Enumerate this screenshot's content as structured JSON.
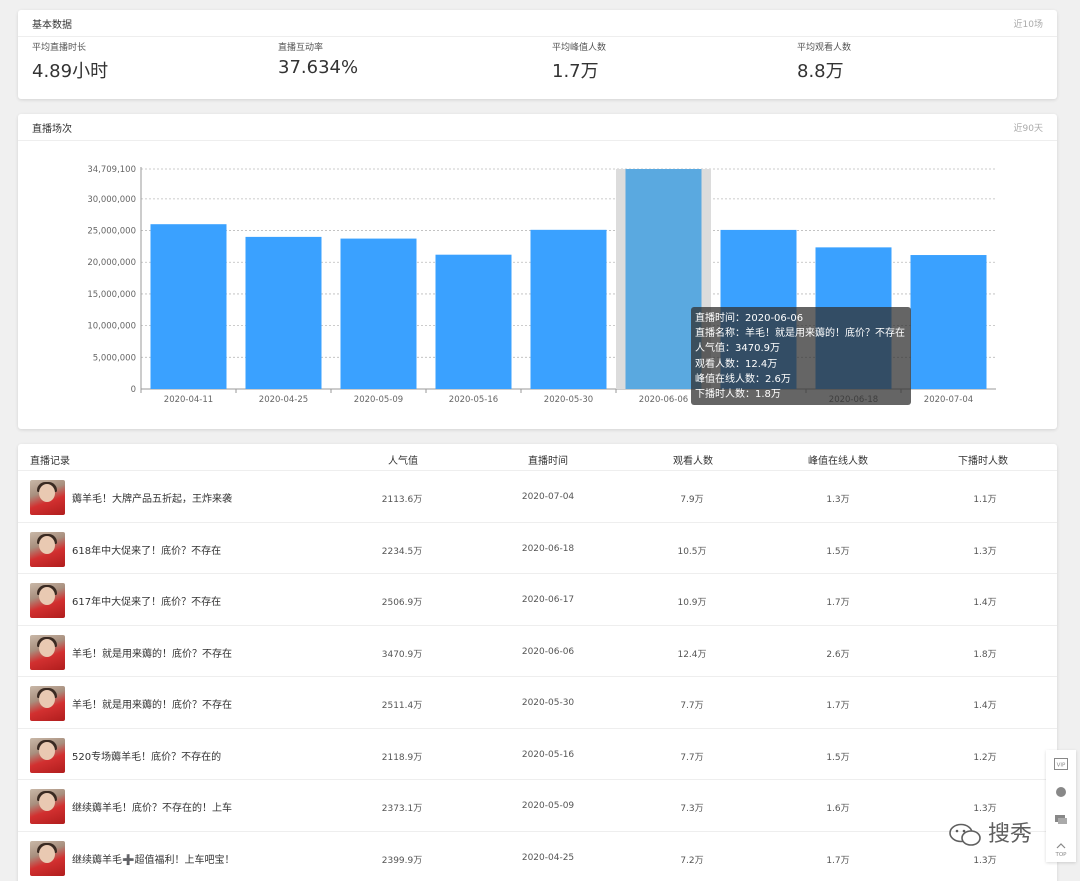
{
  "basic": {
    "title": "基本数据",
    "range": "近10场",
    "stats": [
      {
        "label": "平均直播时长",
        "value": "4.89小时"
      },
      {
        "label": "直播互动率",
        "value": "37.634%"
      },
      {
        "label": "平均峰值人数",
        "value": "1.7万"
      },
      {
        "label": "平均观看人数",
        "value": "8.8万"
      }
    ]
  },
  "sessions": {
    "title": "直播场次",
    "range": "近90天"
  },
  "chart_data": {
    "type": "bar",
    "categories": [
      "2020-04-11",
      "2020-04-25",
      "2020-05-09",
      "2020-05-16",
      "2020-05-30",
      "2020-06-06",
      "2020-06-18",
      "2020-07-04"
    ],
    "values": [
      26000000,
      23999000,
      23731000,
      21189000,
      25114000,
      34709000,
      25100000,
      22345000,
      21136000
    ],
    "bar_labels": [
      "2020-04-11",
      "2020-04-25",
      "2020-05-09",
      "2020-05-16",
      "2020-05-30",
      "2020-06-06",
      "",
      "2020-06-18",
      "2020-07-04"
    ],
    "y_ticks": [
      "0",
      "5,000,000",
      "10,000,000",
      "15,000,000",
      "20,000,000",
      "25,000,000",
      "30,000,000",
      "34,709,100"
    ],
    "ylim": [
      0,
      34709100
    ],
    "highlight_index": 5,
    "colors": {
      "bar": "#3aa1ff",
      "highlight": "#5aa9e0",
      "highlight_bg": "#dcdcdc",
      "grid": "#bbbbbb"
    },
    "tooltip": [
      "直播时间：2020-06-06",
      "直播名称：羊毛！就是用来薅的！底价？不存在",
      "人气值：3470.9万",
      "观看人数：12.4万",
      "峰值在线人数：2.6万",
      "下播时人数：1.8万"
    ]
  },
  "records": {
    "headers": [
      "直播记录",
      "人气值",
      "直播时间",
      "观看人数",
      "峰值在线人数",
      "下播时人数"
    ],
    "rows": [
      {
        "title": "薅羊毛！大牌产品五折起，王炸来袭",
        "popularity": "2113.6万",
        "date": "2020-07-04",
        "viewers": "7.9万",
        "peak": "1.3万",
        "end": "1.1万"
      },
      {
        "title": "618年中大促来了！底价？不存在",
        "popularity": "2234.5万",
        "date": "2020-06-18",
        "viewers": "10.5万",
        "peak": "1.5万",
        "end": "1.3万"
      },
      {
        "title": "617年中大促来了！底价？不存在",
        "popularity": "2506.9万",
        "date": "2020-06-17",
        "viewers": "10.9万",
        "peak": "1.7万",
        "end": "1.4万"
      },
      {
        "title": "羊毛！就是用来薅的！底价？不存在",
        "popularity": "3470.9万",
        "date": "2020-06-06",
        "viewers": "12.4万",
        "peak": "2.6万",
        "end": "1.8万"
      },
      {
        "title": "羊毛！就是用来薅的！底价？不存在",
        "popularity": "2511.4万",
        "date": "2020-05-30",
        "viewers": "7.7万",
        "peak": "1.7万",
        "end": "1.4万"
      },
      {
        "title": "520专场薅羊毛！底价？不存在的",
        "popularity": "2118.9万",
        "date": "2020-05-16",
        "viewers": "7.7万",
        "peak": "1.5万",
        "end": "1.2万"
      },
      {
        "title": "继续薅羊毛！底价？不存在的！上车",
        "popularity": "2373.1万",
        "date": "2020-05-09",
        "viewers": "7.3万",
        "peak": "1.6万",
        "end": "1.3万"
      },
      {
        "title": "继续薅羊毛➕超值福利！上车吧宝！",
        "popularity": "2399.9万",
        "date": "2020-04-25",
        "viewers": "7.2万",
        "peak": "1.7万",
        "end": "1.3万"
      }
    ]
  },
  "sidebar": {
    "vip": "VIP",
    "top": "TOP"
  },
  "watermark": "搜秀"
}
